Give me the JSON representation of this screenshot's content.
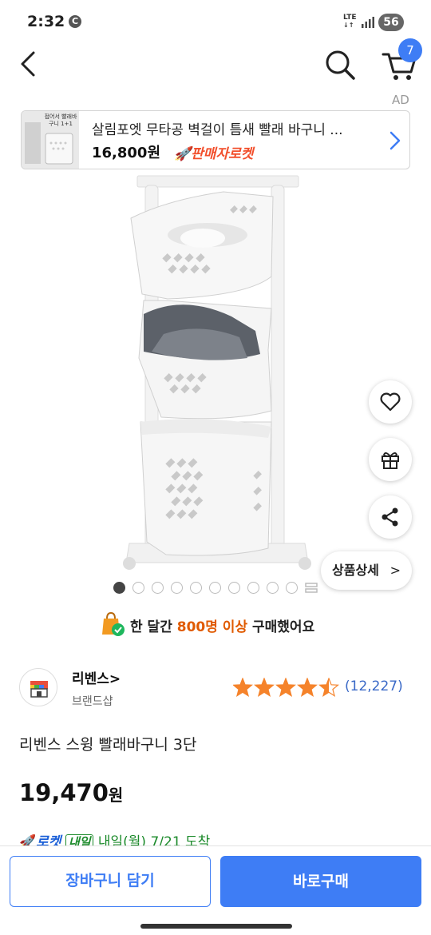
{
  "status_bar": {
    "time": "2:32",
    "notification_glyph": "C",
    "network": "LTE",
    "battery": "56"
  },
  "header": {
    "back_icon": "chevron-left-icon",
    "search_icon": "search-icon",
    "cart_icon": "cart-icon",
    "cart_count": "7",
    "accent_color": "#3e7df5"
  },
  "ad": {
    "label": "AD",
    "title": "살림포엣 무타공 벽걸이 틈새 빨래 바구니 ...",
    "price": "16,800원",
    "badge": "판매자로켓",
    "thumbnail_caption": "접어서 빨래바구니 1+1"
  },
  "product": {
    "image_alt": "3-tier white laundry basket rack with wheels",
    "carousel": {
      "total": 10,
      "active": 0
    },
    "floating": {
      "wish_icon": "heart-icon",
      "gift_icon": "gift-icon",
      "share_icon": "share-icon",
      "detail_label": "상품상세",
      "detail_chevron": ">"
    },
    "purchase": {
      "prefix": "한 달간 ",
      "highlight": "800명 이상",
      "suffix": " 구매했어요",
      "highlight_color": "#e05a00"
    },
    "seller": {
      "name": "리벤스>",
      "type": "브랜드샵"
    },
    "rating": {
      "stars": 4.5,
      "max": 5,
      "reviews": "(12,227)"
    },
    "name": "리벤스 스윙 빨래바구니 3단",
    "price": "19,470",
    "price_unit": "원",
    "delivery": {
      "rocket_label": "로켓",
      "tag": "내일",
      "date_text": "내일(월) 7/21 도착"
    }
  },
  "bottom_bar": {
    "add_to_cart": "장바구니 담기",
    "buy_now": "바로구매"
  }
}
